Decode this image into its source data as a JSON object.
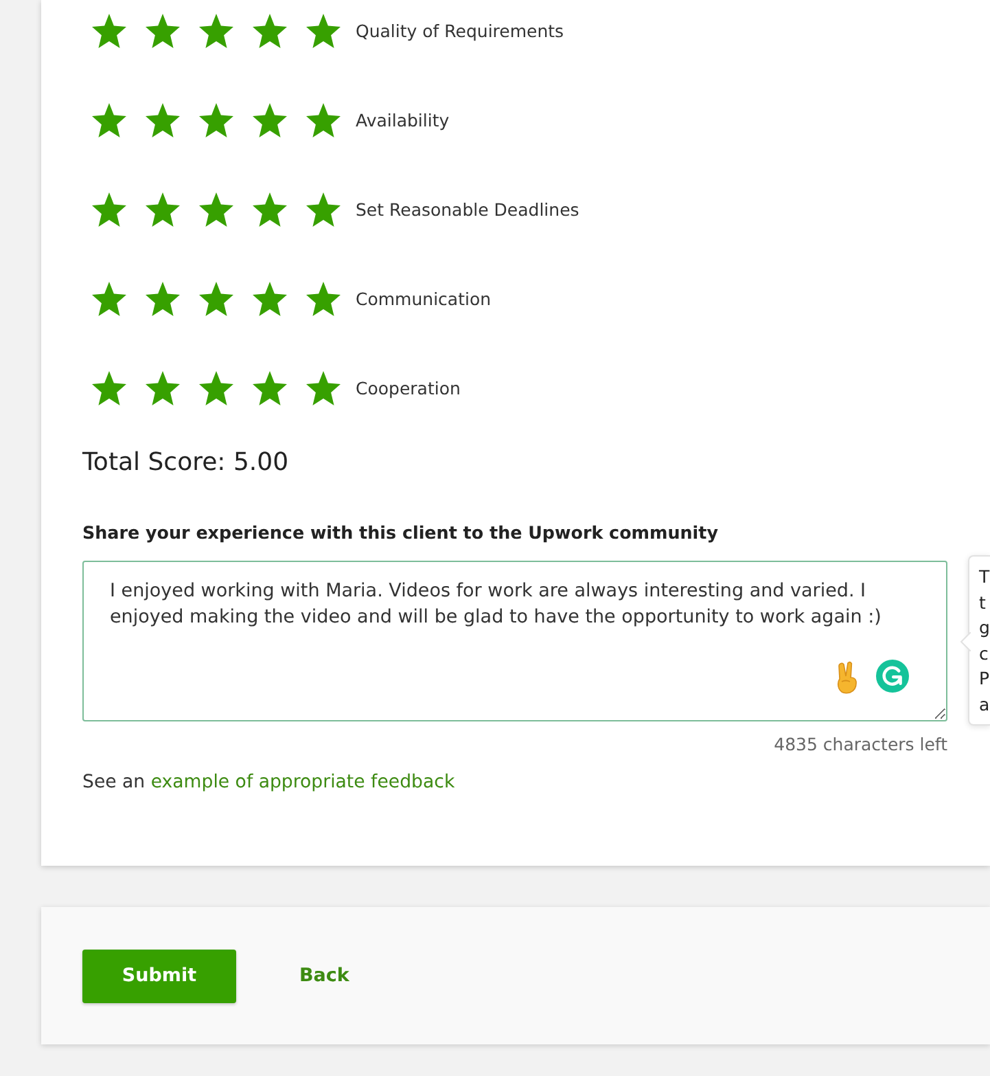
{
  "ratings": [
    {
      "label": "Quality of Requirements",
      "stars": 5
    },
    {
      "label": "Availability",
      "stars": 5
    },
    {
      "label": "Set Reasonable Deadlines",
      "stars": 5
    },
    {
      "label": "Communication",
      "stars": 5
    },
    {
      "label": "Cooperation",
      "stars": 5
    }
  ],
  "total_score": "Total Score: 5.00",
  "feedback": {
    "label": "Share your experience with this client to the Upwork community",
    "value": "I enjoyed working with Maria. Videos for work are always interesting and varied. I enjoyed making the video and will be glad to have the opportunity to work again :)",
    "characters_left": "4835 characters left"
  },
  "tooltip": {
    "lines": [
      "T",
      "t",
      "g",
      "c",
      "P",
      "a"
    ]
  },
  "hint": {
    "prefix": "See an",
    "link": "example of appropriate feedback"
  },
  "actions": [
    {
      "label": "Submit",
      "kind": "primary"
    },
    {
      "label": "Back",
      "kind": "link"
    }
  ]
}
